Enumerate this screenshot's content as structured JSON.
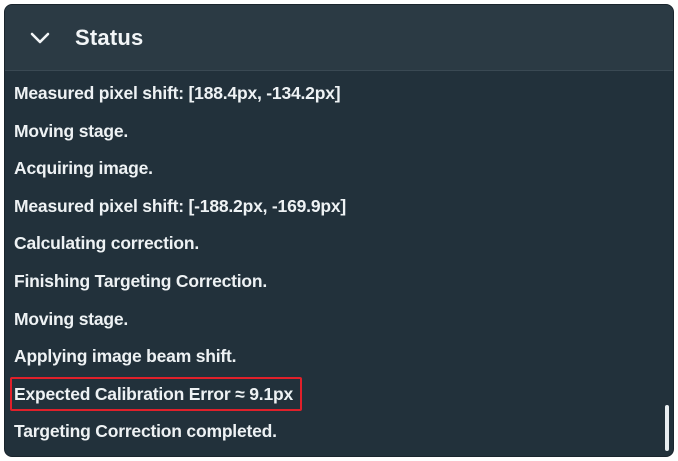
{
  "panel": {
    "title": "Status",
    "chevron_icon": "chevron-down-icon",
    "expanded": true
  },
  "log": [
    "Measured pixel shift: [188.4px, -134.2px]",
    "Moving stage.",
    "Acquiring image.",
    "Measured pixel shift: [-188.2px, -169.9px]",
    "Calculating correction.",
    "Finishing Targeting Correction.",
    "Moving stage.",
    "Applying image beam shift.",
    "Expected Calibration Error ≈ 9.1px",
    "Targeting Correction completed."
  ],
  "highlighted_line_index": 8,
  "colors": {
    "panel_background": "#22313b",
    "header_background": "#2b3a44",
    "text": "#eef2f4",
    "highlight_border": "#e0202a"
  }
}
